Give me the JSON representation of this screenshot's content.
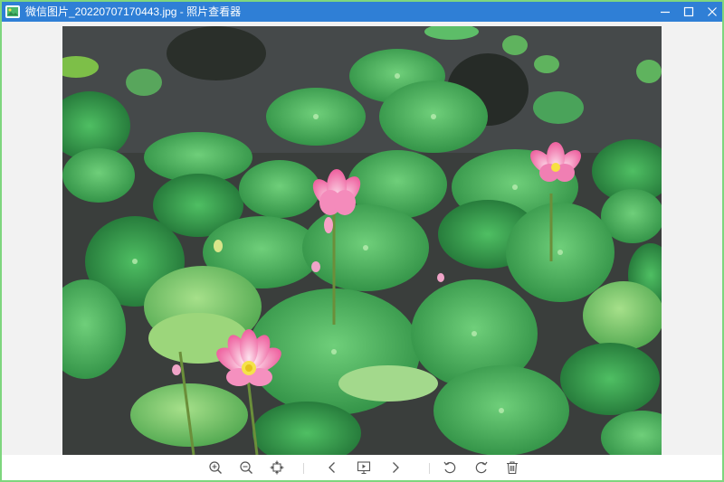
{
  "window": {
    "title": "微信图片_20220707170443.jpg - 照片查看器",
    "accent_color": "#2f7fd6",
    "frame_color": "#7ed67e"
  },
  "titlebar": {
    "app_icon": "photo-viewer-icon",
    "buttons": [
      "minimize-icon",
      "maximize-icon",
      "close-icon"
    ]
  },
  "image": {
    "subject": "pink lotus flowers among green lotus leaves on a pond"
  },
  "toolbar": {
    "icons": [
      "zoom-in-icon",
      "zoom-out-icon",
      "fit-to-window-icon",
      "previous-icon",
      "slideshow-icon",
      "next-icon",
      "rotate-left-icon",
      "rotate-right-icon",
      "delete-icon"
    ]
  }
}
